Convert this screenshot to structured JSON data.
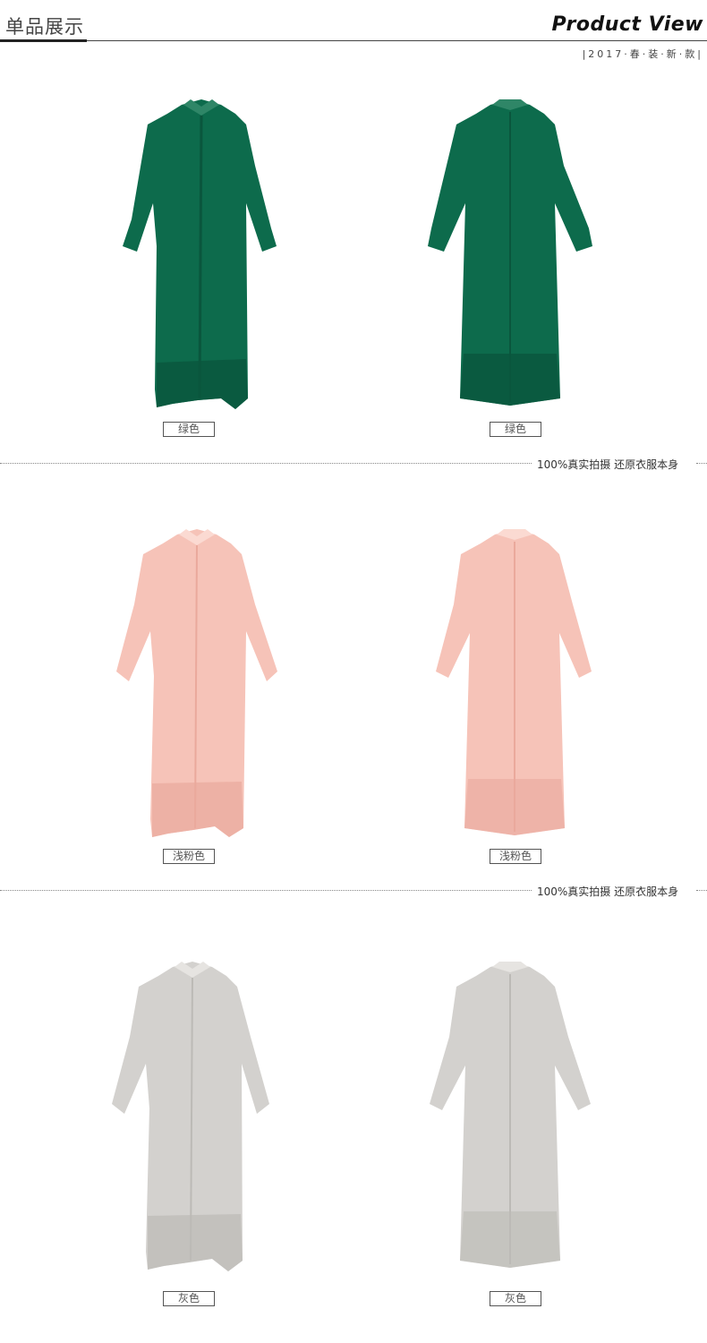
{
  "header": {
    "title_cn": "单品展示",
    "title_en": "Product View",
    "subtitle": "|2017·春·装·新·款|"
  },
  "sections": [
    {
      "color_name": "绿色",
      "color_hex": "#0d6b4c",
      "shade_hex": "#0a563d",
      "light_hex": "#2f8667"
    },
    {
      "color_name": "浅粉色",
      "color_hex": "#f6c3b8",
      "shade_hex": "#eaa99c",
      "light_hex": "#fbdad2"
    },
    {
      "color_name": "灰色",
      "color_hex": "#d3d1ce",
      "shade_hex": "#bcbab6",
      "light_hex": "#e6e4e1"
    }
  ],
  "divider_note": "100%真实拍摄 还原衣服本身",
  "icons": {
    "front": "shirt-dress-front-icon",
    "back": "shirt-dress-back-icon"
  }
}
